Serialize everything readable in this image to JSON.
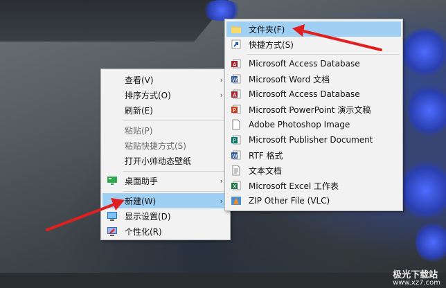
{
  "context_menu": {
    "items": [
      {
        "label": "查看(V)",
        "submenu": true
      },
      {
        "label": "排序方式(O)",
        "submenu": true
      },
      {
        "label": "刷新(E)"
      },
      {
        "label": "粘贴(P)",
        "disabled": true
      },
      {
        "label": "粘贴快捷方式(S)",
        "disabled": true
      },
      {
        "label": "打开小帅动态壁纸"
      },
      {
        "label": "桌面助手",
        "submenu": true,
        "icon": "monitor-icon"
      },
      {
        "label": "新建(W)",
        "submenu": true,
        "highlighted": true
      },
      {
        "label": "显示设置(D)",
        "icon": "display-settings-icon"
      },
      {
        "label": "个性化(R)",
        "icon": "personalize-icon"
      }
    ]
  },
  "new_submenu": {
    "items": [
      {
        "label": "文件夹(F)",
        "icon": "folder-icon",
        "highlighted": true
      },
      {
        "label": "快捷方式(S)",
        "icon": "shortcut-icon"
      },
      {
        "label": "Microsoft Access Database",
        "icon": "access-icon"
      },
      {
        "label": "Microsoft Word 文档",
        "icon": "word-icon"
      },
      {
        "label": "Microsoft Access Database",
        "icon": "access-icon"
      },
      {
        "label": "Microsoft PowerPoint 演示文稿",
        "icon": "powerpoint-icon"
      },
      {
        "label": "Adobe Photoshop Image",
        "icon": "blank-file-icon"
      },
      {
        "label": "Microsoft Publisher Document",
        "icon": "publisher-icon"
      },
      {
        "label": "RTF 格式",
        "icon": "rtf-icon"
      },
      {
        "label": "文本文档",
        "icon": "text-file-icon"
      },
      {
        "label": "Microsoft Excel 工作表",
        "icon": "excel-icon"
      },
      {
        "label": "ZIP Other File (VLC)",
        "icon": "vlc-zip-icon"
      }
    ]
  },
  "watermark": {
    "title": "极光下载站",
    "url": "www.xz7.com"
  },
  "colors": {
    "highlight": "#9fd0f3",
    "annotation_arrow": "#e02020",
    "menu_bg": "#f2f2f2"
  }
}
